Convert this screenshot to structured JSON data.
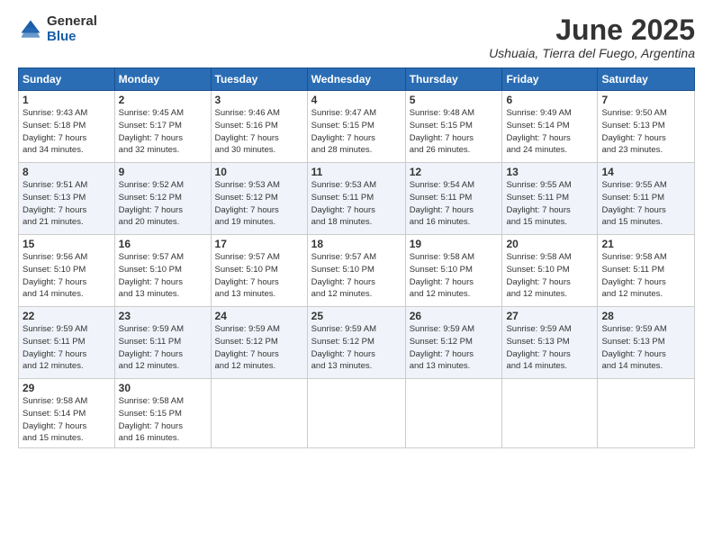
{
  "logo": {
    "general": "General",
    "blue": "Blue"
  },
  "title": "June 2025",
  "subtitle": "Ushuaia, Tierra del Fuego, Argentina",
  "weekdays": [
    "Sunday",
    "Monday",
    "Tuesday",
    "Wednesday",
    "Thursday",
    "Friday",
    "Saturday"
  ],
  "weeks": [
    [
      {
        "day": "1",
        "info": "Sunrise: 9:43 AM\nSunset: 5:18 PM\nDaylight: 7 hours\nand 34 minutes."
      },
      {
        "day": "2",
        "info": "Sunrise: 9:45 AM\nSunset: 5:17 PM\nDaylight: 7 hours\nand 32 minutes."
      },
      {
        "day": "3",
        "info": "Sunrise: 9:46 AM\nSunset: 5:16 PM\nDaylight: 7 hours\nand 30 minutes."
      },
      {
        "day": "4",
        "info": "Sunrise: 9:47 AM\nSunset: 5:15 PM\nDaylight: 7 hours\nand 28 minutes."
      },
      {
        "day": "5",
        "info": "Sunrise: 9:48 AM\nSunset: 5:15 PM\nDaylight: 7 hours\nand 26 minutes."
      },
      {
        "day": "6",
        "info": "Sunrise: 9:49 AM\nSunset: 5:14 PM\nDaylight: 7 hours\nand 24 minutes."
      },
      {
        "day": "7",
        "info": "Sunrise: 9:50 AM\nSunset: 5:13 PM\nDaylight: 7 hours\nand 23 minutes."
      }
    ],
    [
      {
        "day": "8",
        "info": "Sunrise: 9:51 AM\nSunset: 5:13 PM\nDaylight: 7 hours\nand 21 minutes."
      },
      {
        "day": "9",
        "info": "Sunrise: 9:52 AM\nSunset: 5:12 PM\nDaylight: 7 hours\nand 20 minutes."
      },
      {
        "day": "10",
        "info": "Sunrise: 9:53 AM\nSunset: 5:12 PM\nDaylight: 7 hours\nand 19 minutes."
      },
      {
        "day": "11",
        "info": "Sunrise: 9:53 AM\nSunset: 5:11 PM\nDaylight: 7 hours\nand 18 minutes."
      },
      {
        "day": "12",
        "info": "Sunrise: 9:54 AM\nSunset: 5:11 PM\nDaylight: 7 hours\nand 16 minutes."
      },
      {
        "day": "13",
        "info": "Sunrise: 9:55 AM\nSunset: 5:11 PM\nDaylight: 7 hours\nand 15 minutes."
      },
      {
        "day": "14",
        "info": "Sunrise: 9:55 AM\nSunset: 5:11 PM\nDaylight: 7 hours\nand 15 minutes."
      }
    ],
    [
      {
        "day": "15",
        "info": "Sunrise: 9:56 AM\nSunset: 5:10 PM\nDaylight: 7 hours\nand 14 minutes."
      },
      {
        "day": "16",
        "info": "Sunrise: 9:57 AM\nSunset: 5:10 PM\nDaylight: 7 hours\nand 13 minutes."
      },
      {
        "day": "17",
        "info": "Sunrise: 9:57 AM\nSunset: 5:10 PM\nDaylight: 7 hours\nand 13 minutes."
      },
      {
        "day": "18",
        "info": "Sunrise: 9:57 AM\nSunset: 5:10 PM\nDaylight: 7 hours\nand 12 minutes."
      },
      {
        "day": "19",
        "info": "Sunrise: 9:58 AM\nSunset: 5:10 PM\nDaylight: 7 hours\nand 12 minutes."
      },
      {
        "day": "20",
        "info": "Sunrise: 9:58 AM\nSunset: 5:10 PM\nDaylight: 7 hours\nand 12 minutes."
      },
      {
        "day": "21",
        "info": "Sunrise: 9:58 AM\nSunset: 5:11 PM\nDaylight: 7 hours\nand 12 minutes."
      }
    ],
    [
      {
        "day": "22",
        "info": "Sunrise: 9:59 AM\nSunset: 5:11 PM\nDaylight: 7 hours\nand 12 minutes."
      },
      {
        "day": "23",
        "info": "Sunrise: 9:59 AM\nSunset: 5:11 PM\nDaylight: 7 hours\nand 12 minutes."
      },
      {
        "day": "24",
        "info": "Sunrise: 9:59 AM\nSunset: 5:12 PM\nDaylight: 7 hours\nand 12 minutes."
      },
      {
        "day": "25",
        "info": "Sunrise: 9:59 AM\nSunset: 5:12 PM\nDaylight: 7 hours\nand 13 minutes."
      },
      {
        "day": "26",
        "info": "Sunrise: 9:59 AM\nSunset: 5:12 PM\nDaylight: 7 hours\nand 13 minutes."
      },
      {
        "day": "27",
        "info": "Sunrise: 9:59 AM\nSunset: 5:13 PM\nDaylight: 7 hours\nand 14 minutes."
      },
      {
        "day": "28",
        "info": "Sunrise: 9:59 AM\nSunset: 5:13 PM\nDaylight: 7 hours\nand 14 minutes."
      }
    ],
    [
      {
        "day": "29",
        "info": "Sunrise: 9:58 AM\nSunset: 5:14 PM\nDaylight: 7 hours\nand 15 minutes."
      },
      {
        "day": "30",
        "info": "Sunrise: 9:58 AM\nSunset: 5:15 PM\nDaylight: 7 hours\nand 16 minutes."
      },
      null,
      null,
      null,
      null,
      null
    ]
  ]
}
